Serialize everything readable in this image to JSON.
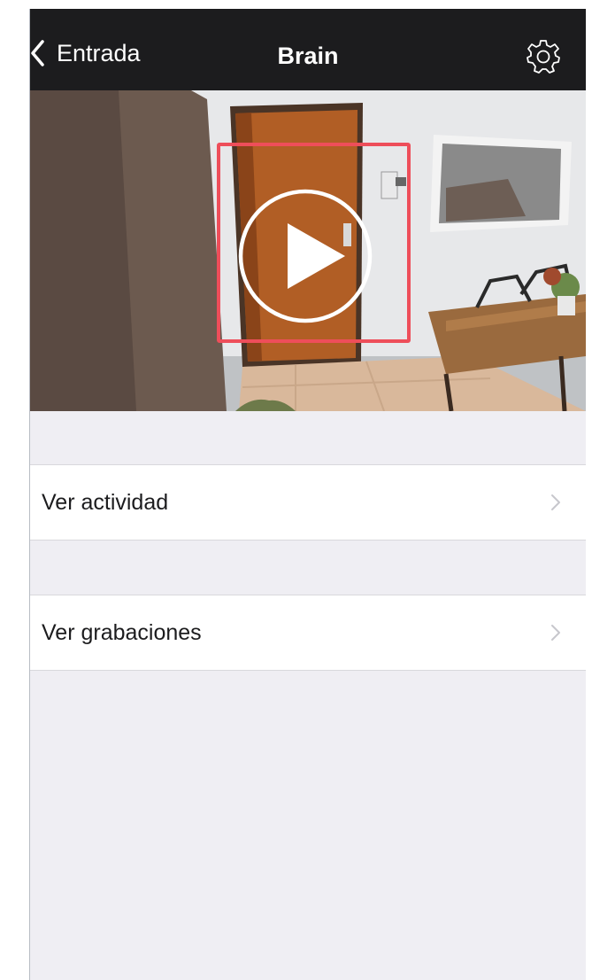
{
  "navbar": {
    "back_label": "Entrada",
    "title": "Brain",
    "settings_icon": "gear-icon"
  },
  "video": {
    "play_icon": "play-icon",
    "highlight_color": "#ee4e5a"
  },
  "menu": [
    {
      "label": "Ver actividad"
    },
    {
      "label": "Ver grabaciones"
    }
  ],
  "colors": {
    "navbar_bg": "#1c1c1e",
    "page_bg": "#efeef3",
    "row_bg": "#ffffff",
    "chevron": "#c7c7cc"
  }
}
